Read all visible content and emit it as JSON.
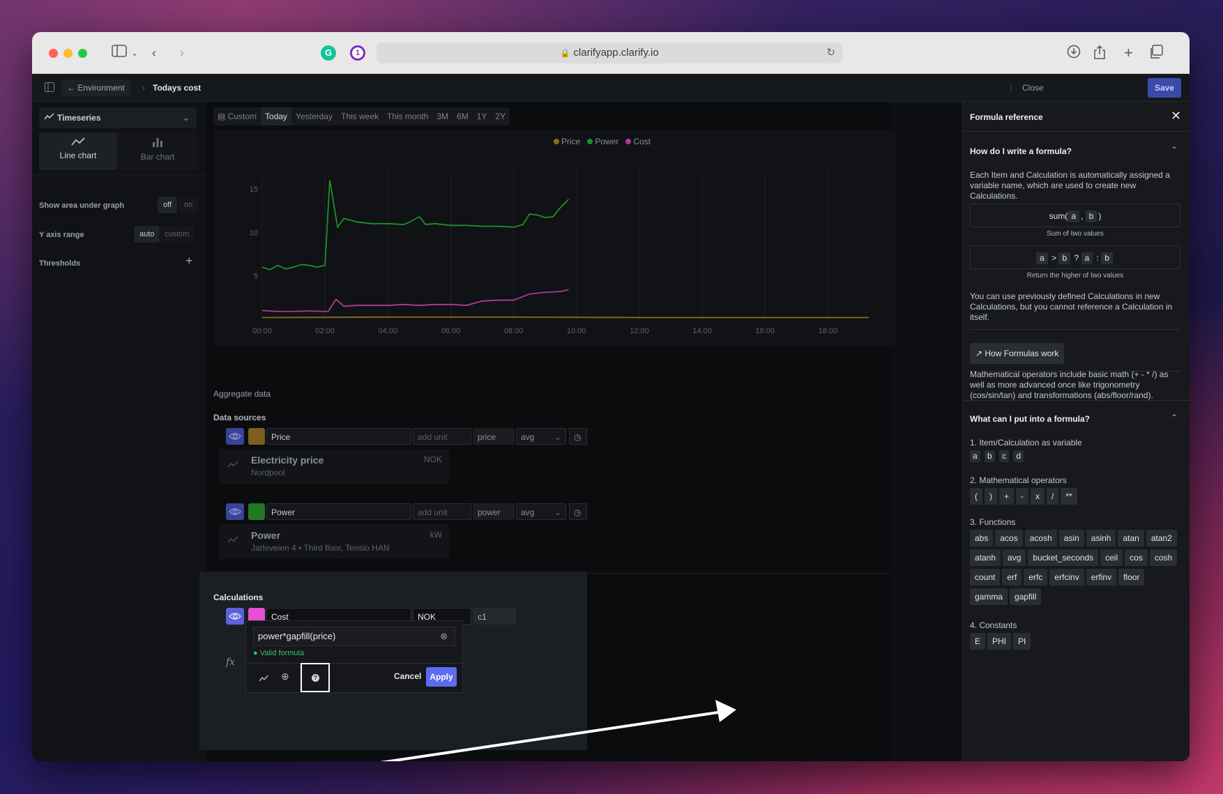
{
  "browser": {
    "url": "clarifyapp.clarify.io"
  },
  "app_bar": {
    "back_label": "Environment",
    "title": "Todays cost",
    "close_label": "Close",
    "save_label": "Save"
  },
  "left_panel": {
    "view_select": "Timeseries",
    "chart_types": [
      {
        "label": "Line chart",
        "icon": "line-chart-icon",
        "active": true
      },
      {
        "label": "Bar chart",
        "icon": "bar-chart-icon",
        "active": false
      }
    ],
    "show_area_label": "Show area under graph",
    "show_area_options": [
      "off",
      "on"
    ],
    "show_area_selected": "off",
    "y_axis_label": "Y axis range",
    "y_axis_options": [
      "auto",
      "custom"
    ],
    "y_axis_selected": "auto",
    "thresholds_label": "Thresholds"
  },
  "range_tabs": [
    "Custom",
    "Today",
    "Yesterday",
    "This week",
    "This month",
    "3M",
    "6M",
    "1Y",
    "2Y"
  ],
  "range_selected": "Today",
  "chart_data": {
    "type": "line",
    "legend": [
      "Price",
      "Power",
      "Cost"
    ],
    "colors": {
      "Price": "#8c6d1f",
      "Power": "#1f8f2a",
      "Cost": "#b03a9c"
    },
    "x_ticks": [
      "00:00",
      "02:00",
      "04:00",
      "06:00",
      "08:00",
      "10:00",
      "12:00",
      "14:00",
      "16:00",
      "18:00"
    ],
    "y_ticks": [
      "5",
      "10",
      "15"
    ],
    "xlim": [
      0,
      19.3
    ],
    "ylim": [
      0,
      17
    ],
    "series": [
      {
        "name": "Power",
        "x": [
          0,
          0.25,
          0.5,
          0.75,
          1,
          1.25,
          1.5,
          1.75,
          2,
          2.15,
          2.4,
          2.6,
          3,
          3.5,
          4,
          4.5,
          4.7,
          5,
          5.2,
          5.5,
          6,
          6.5,
          7,
          7.5,
          8,
          8.3,
          8.5,
          8.75,
          9,
          9.25,
          9.5,
          9.75
        ],
        "y": [
          6,
          5.7,
          6.2,
          5.8,
          6.0,
          6.3,
          6.2,
          6.0,
          6.2,
          16.0,
          10.6,
          11.6,
          11.2,
          11.0,
          11.0,
          10.9,
          11.2,
          11.8,
          10.9,
          11.0,
          10.8,
          10.8,
          10.7,
          10.7,
          10.6,
          10.9,
          12.1,
          12.0,
          11.7,
          11.8,
          12.9,
          13.8
        ]
      },
      {
        "name": "Cost",
        "x": [
          0,
          0.5,
          1,
          1.5,
          2,
          2.1,
          2.35,
          2.6,
          3,
          3.5,
          4,
          4.5,
          5,
          5.5,
          6,
          6.5,
          7,
          7.5,
          8,
          8.5,
          9,
          9.5,
          9.75
        ],
        "y": [
          1.0,
          0.9,
          0.9,
          0.95,
          0.9,
          0.9,
          2.3,
          1.5,
          1.6,
          1.6,
          1.6,
          1.7,
          1.6,
          1.7,
          1.7,
          1.6,
          2.1,
          2.2,
          2.2,
          2.9,
          3.1,
          3.2,
          3.4
        ]
      },
      {
        "name": "Price",
        "x": [
          0,
          4,
          8,
          12,
          16,
          19.3
        ],
        "y": [
          0.2,
          0.25,
          0.25,
          0.2,
          0.2,
          0.2
        ]
      }
    ]
  },
  "aggregate_label": "Aggregate data",
  "data_sources_label": "Data sources",
  "data_sources": [
    {
      "name": "Price",
      "unit_placeholder": "add unit",
      "variable": "price",
      "agg": "avg",
      "color": "#7c5f1e",
      "card_title": "Electricity price",
      "card_sub": "Nordpool",
      "card_unit": "NOK"
    },
    {
      "name": "Power",
      "unit_placeholder": "add unit",
      "variable": "power",
      "agg": "avg",
      "color": "#1f7a25",
      "card_title": "Power",
      "card_sub": "Jarleveien 4 • Third floor, Tensio HAN",
      "card_unit": "kW"
    }
  ],
  "calculations_label": "Calculations",
  "calculation": {
    "name": "Cost",
    "unit": "NOK",
    "variable": "c1",
    "color": "#e64fd6",
    "formula": "power*gapfill(price)",
    "valid_text": "Valid formula",
    "cancel_label": "Cancel",
    "apply_label": "Apply"
  },
  "reference": {
    "title": "Formula reference",
    "q1": "How do I write a formula?",
    "intro": "Each Item and Calculation is automatically assigned a variable name, which are used to create new Calculations.",
    "example1_caption": "Sum of two values",
    "example2_caption": "Return the higher of two values",
    "note": "You can use previously defined Calculations in new Calculations, but you cannot reference a Calculation in itself.",
    "how_label": "How Formulas work",
    "operators_text": "Mathematical operators include basic math (+ - * /) as well as more advanced once like trigonometry (cos/sin/tan) and transformations (abs/floor/rand).",
    "q2": "What can I put into a formula?",
    "item_heading": "1. Item/Calculation as variable",
    "variables": [
      "a",
      "b",
      "c",
      "d"
    ],
    "ops_heading": "2. Mathematical operators",
    "operators": [
      "(",
      ")",
      "+",
      "-",
      "x",
      "/",
      "**"
    ],
    "fn_heading": "3. Functions",
    "functions": [
      "abs",
      "acos",
      "acosh",
      "asin",
      "asinh",
      "atan",
      "atan2",
      "atanh",
      "avg",
      "bucket_seconds",
      "ceil",
      "cos",
      "cosh",
      "count",
      "erf",
      "erfc",
      "erfcinv",
      "erfinv",
      "floor",
      "gamma",
      "gapfill"
    ],
    "const_heading": "4. Constants",
    "constants": [
      "E",
      "PHI",
      "PI"
    ]
  }
}
